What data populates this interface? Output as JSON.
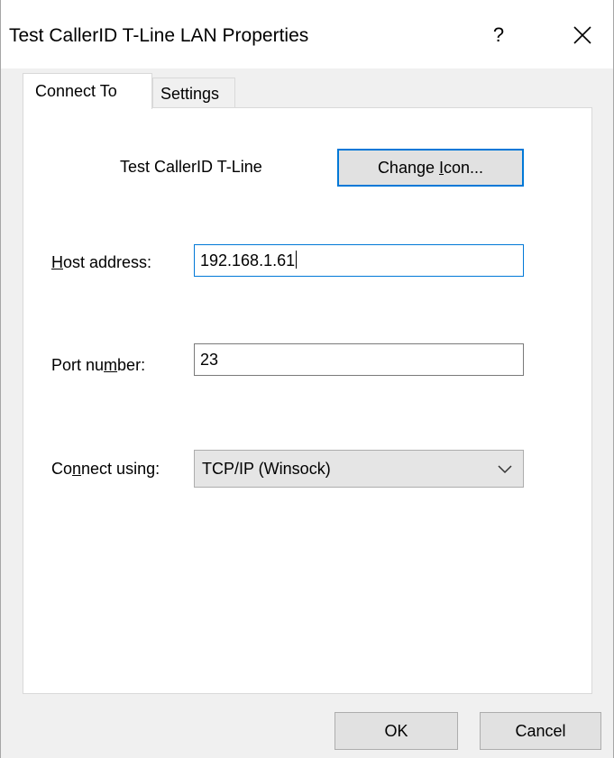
{
  "window": {
    "title": "Test CallerID T-Line LAN Properties",
    "help_label": "?",
    "close_icon": "close-icon"
  },
  "tabs": [
    {
      "label": "Connect To",
      "active": true
    },
    {
      "label": "Settings",
      "active": false
    }
  ],
  "connect_to": {
    "connection_name": "Test CallerID T-Line",
    "change_icon_label_pre": "Change ",
    "change_icon_label_mnemonic": "I",
    "change_icon_label_post": "con...",
    "host_address": {
      "label_mnemonic": "H",
      "label_rest": "ost address:",
      "value": "192.168.1.61"
    },
    "port_number": {
      "label_pre": "Port nu",
      "label_mnemonic": "m",
      "label_post": "ber:",
      "value": "23"
    },
    "connect_using": {
      "label_pre": "Co",
      "label_mnemonic": "n",
      "label_post": "nect using:",
      "selected": "TCP/IP (Winsock)",
      "arrow_icon": "chevron-down-icon"
    }
  },
  "footer": {
    "ok_label": "OK",
    "cancel_label": "Cancel"
  },
  "colors": {
    "accent": "#0078d7",
    "dialog_bg": "#f0f0f0",
    "panel_bg": "#ffffff"
  }
}
